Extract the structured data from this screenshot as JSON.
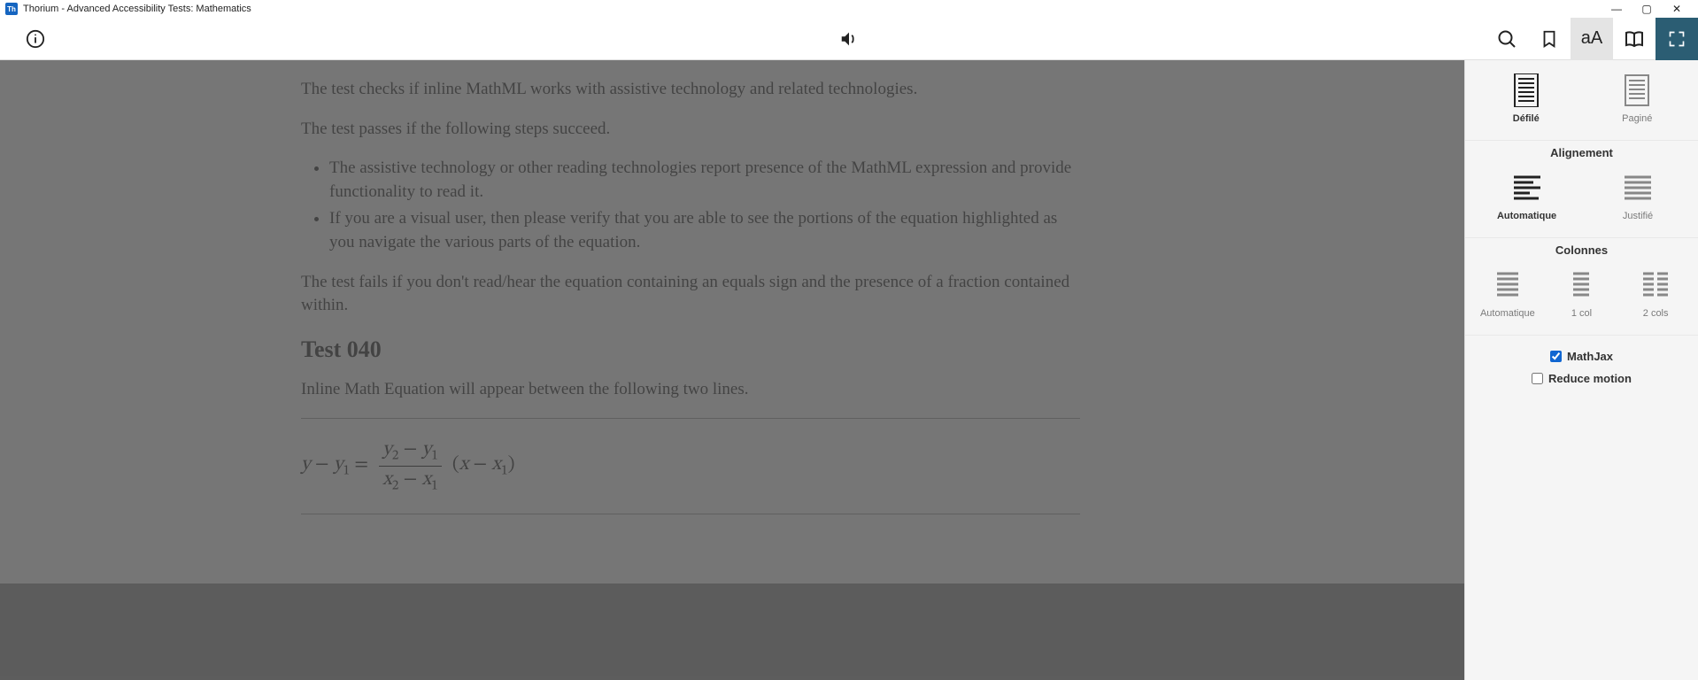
{
  "window": {
    "title": "Thorium - Advanced Accessibility Tests: Mathematics",
    "app_short": "Th"
  },
  "toolbar": {
    "info_icon": "info-icon",
    "audio_icon": "speaker-icon",
    "search_icon": "search-icon",
    "bookmark_icon": "bookmark-icon",
    "aa_label": "aA",
    "toc_icon": "book-open-icon",
    "fullscreen_icon": "fullscreen-icon"
  },
  "content": {
    "intro": "The test checks if inline MathML works with assistive technology and related technologies.",
    "passes_intro": "The test passes if the following steps succeed.",
    "steps": [
      "The assistive technology or other reading technologies report presence of the MathML expression and provide functionality to read it.",
      "If you are a visual user, then please verify that you are able to see the portions of the equation highlighted as you navigate the various parts of the equation."
    ],
    "fails_text": "The test fails if you don't read/hear the equation containing an equals sign and the presence of a fraction contained within.",
    "test_heading": "Test 040",
    "inline_msg": "Inline Math Equation will appear between the following two lines.",
    "equation_text": "y − y₁ = (y₂ − y₁)/(x₂ − x₁) · (x − x₁)"
  },
  "sidebar": {
    "layout": {
      "defile": "Défilé",
      "pagine": "Paginé"
    },
    "align": {
      "title": "Alignement",
      "auto": "Automatique",
      "just": "Justifié"
    },
    "columns": {
      "title": "Colonnes",
      "auto": "Automatique",
      "one": "1 col",
      "two": "2 cols"
    },
    "checks": {
      "mathjax": "MathJax",
      "reduce": "Reduce motion"
    }
  }
}
